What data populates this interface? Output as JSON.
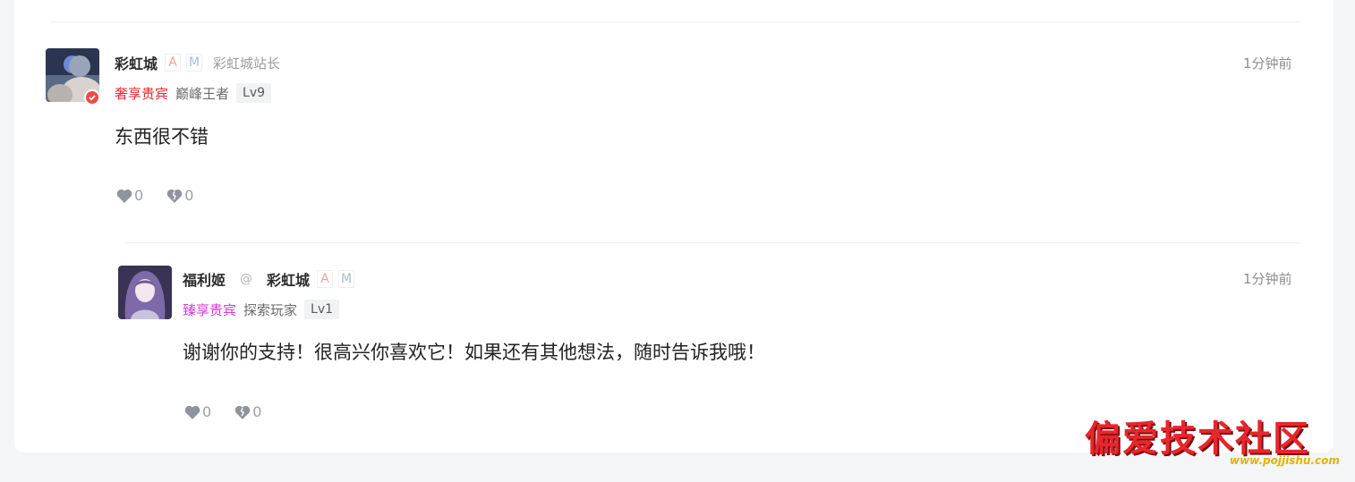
{
  "comment": {
    "username": "彩虹城",
    "badge_a": "A",
    "badge_m": "M",
    "title": "彩虹城站长",
    "vip": "奢享贵宾",
    "vip_color": "#e8262c",
    "rank": "巅峰王者",
    "level": "Lv9",
    "time": "1分钟前",
    "text": "东西很不错",
    "like_icon": "heart-icon",
    "like_count": "0",
    "dislike_icon": "broken-heart-icon",
    "dislike_count": "0"
  },
  "reply": {
    "username": "福利姬",
    "at_symbol": "@",
    "reply_to": "彩虹城",
    "badge_a": "A",
    "badge_m": "M",
    "vip": "臻享贵宾",
    "vip_color": "#d43ad9",
    "rank": "探索玩家",
    "level": "Lv1",
    "time": "1分钟前",
    "text": "谢谢你的支持！很高兴你喜欢它！如果还有其他想法，随时告诉我哦！",
    "like_icon": "heart-icon",
    "like_count": "0",
    "dislike_icon": "broken-heart-icon",
    "dislike_count": "0"
  },
  "watermark": {
    "title": "偏爱技术社区",
    "url": "www.pojjishu.com"
  }
}
